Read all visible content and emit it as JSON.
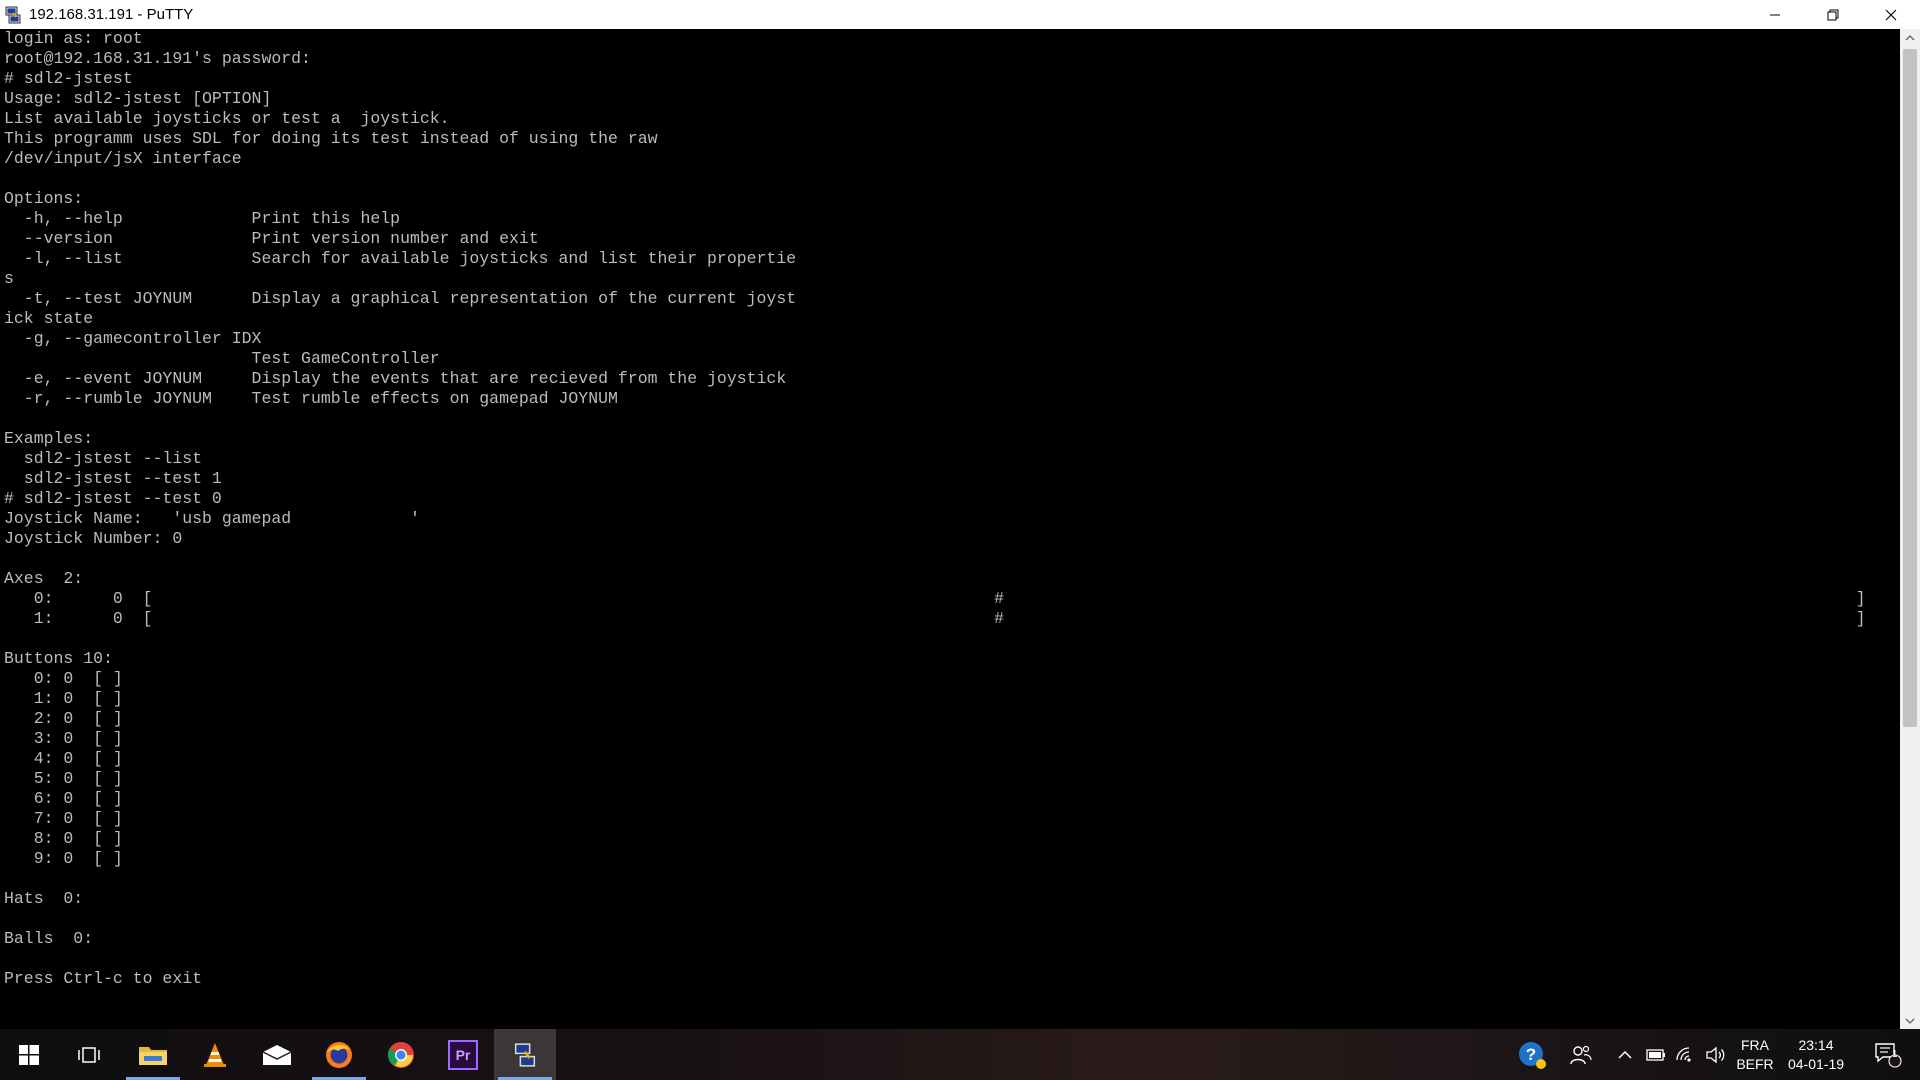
{
  "window": {
    "title": "192.168.31.191 - PuTTY",
    "icon": "putty-icon",
    "controls": [
      "minimize-icon",
      "restore-icon",
      "close-icon"
    ]
  },
  "terminal": {
    "lines": [
      "login as: root",
      "root@192.168.31.191's password:",
      "# sdl2-jstest",
      "Usage: sdl2-jstest [OPTION]",
      "List available joysticks or test a  joystick.",
      "This programm uses SDL for doing its test instead of using the raw",
      "/dev/input/jsX interface",
      "",
      "Options:",
      "  -h, --help             Print this help",
      "  --version              Print version number and exit",
      "  -l, --list             Search for available joysticks and list their propertie",
      "s",
      "  -t, --test JOYNUM      Display a graphical representation of the current joyst",
      "ick state",
      "  -g, --gamecontroller IDX",
      "                         Test GameController",
      "  -e, --event JOYNUM     Display the events that are recieved from the joystick",
      "  -r, --rumble JOYNUM    Test rumble effects on gamepad JOYNUM",
      "",
      "Examples:",
      "  sdl2-jstest --list",
      "  sdl2-jstest --test 1",
      "# sdl2-jstest --test 0",
      "Joystick Name:   'usb gamepad            '",
      "Joystick Number: 0",
      "",
      "Axes  2:",
      "   0:      0  [                                                                                     #                                                                                      ]",
      "   1:      0  [                                                                                     #                                                                                      ]",
      "",
      "Buttons 10:",
      "   0: 0  [ ]",
      "   1: 0  [ ]",
      "   2: 0  [ ]",
      "   3: 0  [ ]",
      "   4: 0  [ ]",
      "   5: 0  [ ]",
      "   6: 0  [ ]",
      "   7: 0  [ ]",
      "   8: 0  [ ]",
      "   9: 0  [ ]",
      "",
      "Hats  0:",
      "",
      "Balls  0:",
      "",
      "Press Ctrl-c to exit"
    ]
  },
  "taskbar": {
    "apps": [
      {
        "name": "start-button",
        "icon": "windows-logo-icon",
        "active": false
      },
      {
        "name": "task-view-button",
        "icon": "task-view-icon",
        "active": false
      },
      {
        "name": "file-explorer-button",
        "icon": "folder-icon",
        "active": false,
        "running": true
      },
      {
        "name": "vlc-button",
        "icon": "vlc-cone-icon",
        "active": false
      },
      {
        "name": "mail-button",
        "icon": "mail-icon",
        "active": false
      },
      {
        "name": "firefox-button",
        "icon": "firefox-icon",
        "active": false,
        "running": true
      },
      {
        "name": "chrome-button",
        "icon": "chrome-icon",
        "active": false
      },
      {
        "name": "premiere-button",
        "icon": "premiere-pro-icon",
        "label": "Pr",
        "active": false
      },
      {
        "name": "putty-button",
        "icon": "putty-icon",
        "active": true,
        "running": true
      }
    ],
    "tray": {
      "language": "FRA",
      "layout": "BEFR",
      "time": "23:14",
      "date": "04-01-19",
      "notification_count": "1"
    }
  },
  "colors": {
    "terminal_bg": "#000000",
    "terminal_fg": "#bbbbbb",
    "titlebar_bg": "#ffffff",
    "taskbar_underline": "#7aa9e6"
  }
}
